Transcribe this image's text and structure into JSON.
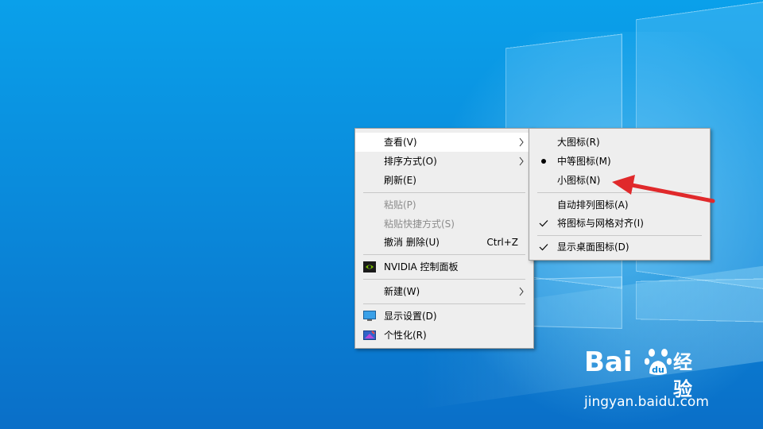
{
  "desktop": {
    "background": "#0a86d8"
  },
  "context_menu": {
    "items": [
      {
        "label": "查看(V)",
        "has_submenu": true,
        "highlighted": true,
        "enabled": true
      },
      {
        "label": "排序方式(O)",
        "has_submenu": true,
        "enabled": true
      },
      {
        "label": "刷新(E)",
        "enabled": true
      },
      {
        "label": "粘贴(P)",
        "enabled": false
      },
      {
        "label": "粘贴快捷方式(S)",
        "enabled": false
      },
      {
        "label": "撤消 删除(U)",
        "shortcut": "Ctrl+Z",
        "enabled": true
      },
      {
        "label": "NVIDIA 控制面板",
        "icon": "nvidia-icon",
        "enabled": true
      },
      {
        "label": "新建(W)",
        "has_submenu": true,
        "enabled": true
      },
      {
        "label": "显示设置(D)",
        "icon": "display-settings-icon",
        "enabled": true
      },
      {
        "label": "个性化(R)",
        "icon": "personalize-icon",
        "enabled": true
      }
    ]
  },
  "view_submenu": {
    "items": [
      {
        "label": "大图标(R)",
        "selected": false
      },
      {
        "label": "中等图标(M)",
        "selected": true,
        "mark": "radio-dot-icon"
      },
      {
        "label": "小图标(N)",
        "selected": false
      },
      {
        "label": "自动排列图标(A)",
        "checked": false
      },
      {
        "label": "将图标与网格对齐(I)",
        "checked": true,
        "mark": "checkmark-icon"
      },
      {
        "label": "显示桌面图标(D)",
        "checked": true,
        "mark": "checkmark-icon"
      }
    ]
  },
  "annotation": {
    "color": "#e0292b",
    "target": "小图标(N)"
  },
  "watermark": {
    "brand": "Bai",
    "brand2": "经验",
    "url": "jingyan.baidu.com"
  }
}
